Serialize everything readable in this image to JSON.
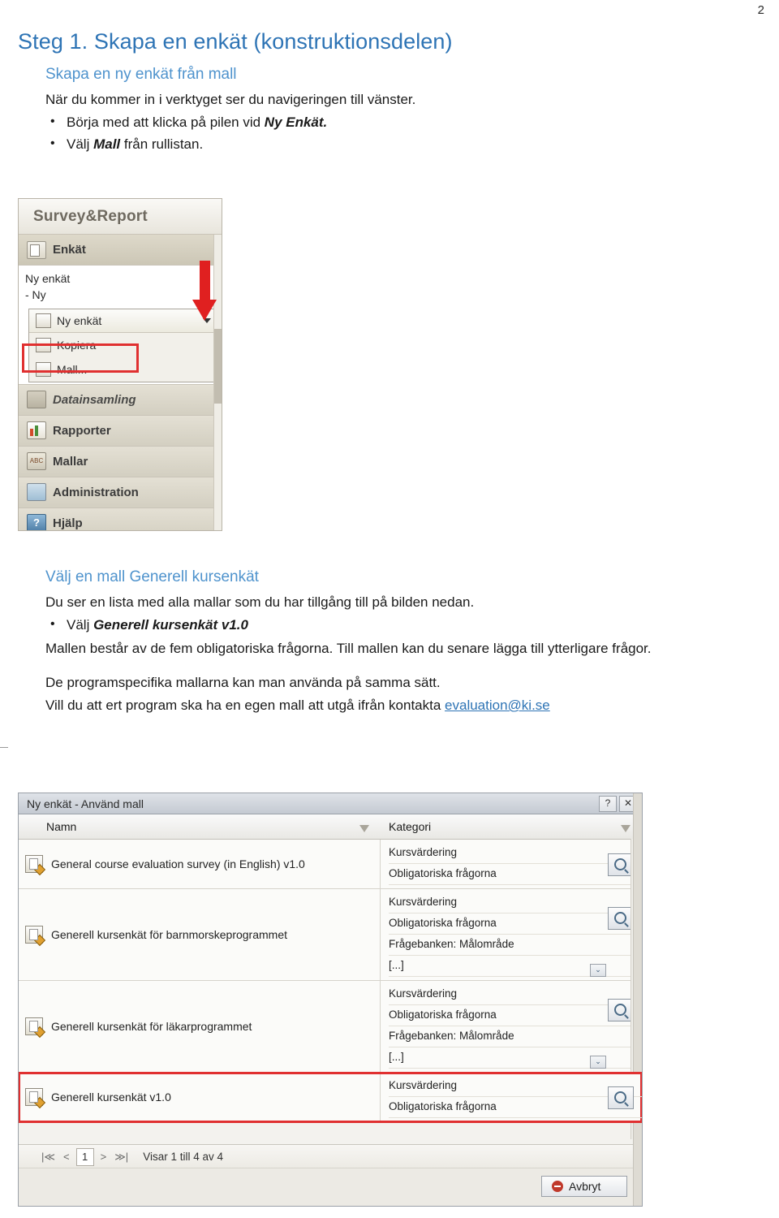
{
  "page": {
    "number": "2"
  },
  "doc": {
    "step_title": "Steg 1. Skapa en enkät (konstruktionsdelen)",
    "section1": {
      "heading": "Skapa en ny enkät från mall",
      "intro": "När du kommer in i verktyget ser du navigeringen till vänster.",
      "bullet1_pre": "Börja med att klicka på pilen vid ",
      "bullet1_em": "Ny Enkät.",
      "bullet2_pre": "Välj ",
      "bullet2_em": "Mall",
      "bullet2_post": " från rullistan."
    },
    "section2": {
      "heading": "Välj en mall Generell kursenkät",
      "intro": "Du ser en lista med alla mallar som du har tillgång till på bilden nedan.",
      "bullet1_pre": "Välj ",
      "bullet1_em": "Generell kursenkät v1.0",
      "para1": "Mallen består av de fem obligatoriska frågorna. Till mallen  kan du senare lägga till ytterligare frågor.",
      "para2": "De programspecifika mallarna kan man använda på samma sätt.",
      "para3_pre": "Vill du att ert program ska ha en egen mall att utgå ifrån kontakta ",
      "para3_link": "evaluation@ki.se"
    }
  },
  "nav_screenshot": {
    "logo": "Survey&Report",
    "items": [
      {
        "label": "Enkät",
        "icon": "survey-icon"
      },
      {
        "label": "Datainsamling",
        "icon": "data-collection-icon"
      },
      {
        "label": "Rapporter",
        "icon": "reports-icon"
      },
      {
        "label": "Mallar",
        "icon": "templates-icon"
      },
      {
        "label": "Administration",
        "icon": "administration-icon"
      },
      {
        "label": "Hjälp",
        "icon": "help-icon"
      }
    ],
    "sub_links": [
      "Ny enkät",
      "- Ny"
    ],
    "dropdown": {
      "selected": "Ny enkät",
      "options": [
        "Kopiera",
        "Mall..."
      ]
    }
  },
  "dialog": {
    "title": "Ny enkät - Använd mall",
    "help_button": "?",
    "close_button": "✕",
    "columns": {
      "name": "Namn",
      "category": "Kategori"
    },
    "rows": [
      {
        "name": "General course evaluation survey (in English) v1.0",
        "categories": [
          "Kursvärdering",
          "Obligatoriska frågorna"
        ],
        "expandable": false,
        "selected": false
      },
      {
        "name": "Generell kursenkät för barnmorskeprogrammet",
        "categories": [
          "Kursvärdering",
          "Obligatoriska frågorna",
          "Frågebanken: Målområde",
          "[...]"
        ],
        "expandable": true,
        "selected": false
      },
      {
        "name": "Generell kursenkät för läkarprogrammet",
        "categories": [
          "Kursvärdering",
          "Obligatoriska frågorna",
          "Frågebanken: Målområde",
          "[...]"
        ],
        "expandable": true,
        "selected": false
      },
      {
        "name": "Generell kursenkät v1.0",
        "categories": [
          "Kursvärdering",
          "Obligatoriska frågorna"
        ],
        "expandable": false,
        "selected": true
      }
    ],
    "pager": {
      "first": "|≪",
      "prev": "<",
      "page": "1",
      "next": ">",
      "last": "≫|",
      "status": "Visar 1 till 4 av 4"
    },
    "cancel_label": "Avbryt"
  },
  "colors": {
    "heading_blue": "#2e74b5",
    "subheading_blue": "#4f93cd",
    "highlight_red": "#e03030"
  }
}
